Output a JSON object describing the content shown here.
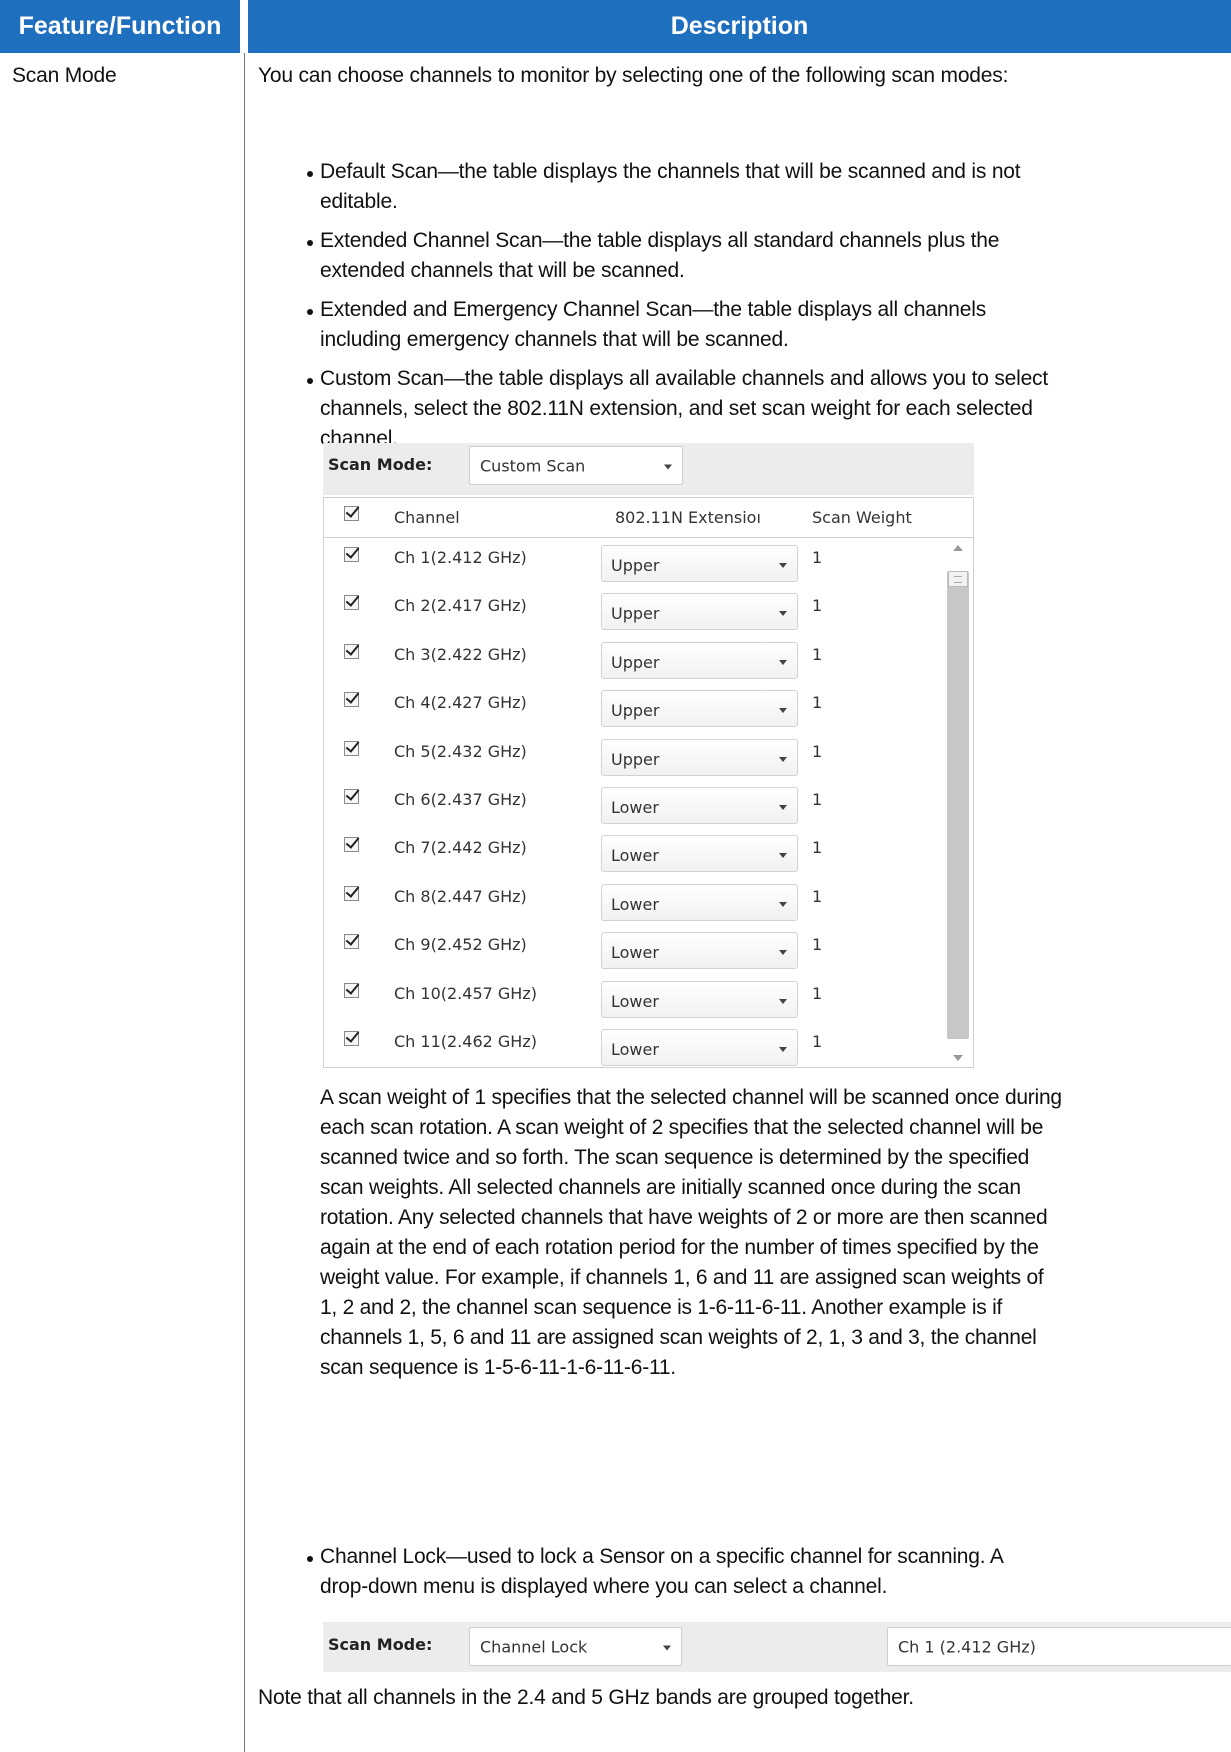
{
  "header": {
    "feature_col": "Feature/Function",
    "description_col": "Description"
  },
  "feature": "Scan Mode",
  "intro": "You can choose channels to monitor by selecting one of the following scan modes:",
  "bullets": {
    "default": [
      "Default Scan—the table displays the channels that will be scanned and is not",
      "editable."
    ],
    "extended": [
      "Extended Channel Scan—the table displays all standard channels plus the",
      "extended channels that will be scanned."
    ],
    "emergency": [
      "Extended and Emergency Channel Scan—the table displays all channels",
      "including emergency channels that will be scanned."
    ],
    "custom": [
      "Custom Scan—the table displays all available channels and allows you to select",
      "channels, select the 802.11N extension, and set scan weight for each selected",
      "channel."
    ],
    "lock": [
      "Channel Lock—used to lock a Sensor on a specific channel for scanning. A",
      "drop-down menu is displayed where you can select a channel."
    ]
  },
  "custom_ui": {
    "scan_mode_label": "Scan Mode:",
    "scan_mode_value": "Custom Scan",
    "columns": {
      "channel": "Channel",
      "extension": "802.11N Extensioı",
      "weight": "Scan Weight"
    },
    "rows": [
      {
        "channel": "Ch 1(2.412 GHz)",
        "extension": "Upper",
        "weight": "1",
        "checked": true
      },
      {
        "channel": "Ch 2(2.417 GHz)",
        "extension": "Upper",
        "weight": "1",
        "checked": true
      },
      {
        "channel": "Ch 3(2.422 GHz)",
        "extension": "Upper",
        "weight": "1",
        "checked": true
      },
      {
        "channel": "Ch 4(2.427 GHz)",
        "extension": "Upper",
        "weight": "1",
        "checked": true
      },
      {
        "channel": "Ch 5(2.432 GHz)",
        "extension": "Upper",
        "weight": "1",
        "checked": true
      },
      {
        "channel": "Ch 6(2.437 GHz)",
        "extension": "Lower",
        "weight": "1",
        "checked": true
      },
      {
        "channel": "Ch 7(2.442 GHz)",
        "extension": "Lower",
        "weight": "1",
        "checked": true
      },
      {
        "channel": "Ch 8(2.447 GHz)",
        "extension": "Lower",
        "weight": "1",
        "checked": true
      },
      {
        "channel": "Ch 9(2.452 GHz)",
        "extension": "Lower",
        "weight": "1",
        "checked": true
      },
      {
        "channel": "Ch 10(2.457 GHz)",
        "extension": "Lower",
        "weight": "1",
        "checked": true
      },
      {
        "channel": "Ch 11(2.462 GHz)",
        "extension": "Lower",
        "weight": "1",
        "checked": true
      }
    ]
  },
  "weight_paragraph": [
    "A scan weight of 1 specifies that the selected channel will be scanned once during",
    "each scan rotation. A scan weight of 2 specifies that the selected channel will be",
    "scanned twice and so forth. The scan sequence is determined by the specified",
    "scan weights. All selected channels are initially scanned once during the scan",
    "rotation. Any selected channels that have weights of 2 or more are then scanned",
    "again at the end of each rotation period for the number of times specified by the",
    "weight value. For example, if channels 1, 6 and 11 are assigned scan weights of",
    "1, 2 and 2, the channel scan sequence is 1-6-11-6-11. Another example is if",
    "channels 1, 5, 6 and 11 are assigned scan weights of 2, 1, 3 and 3, the channel",
    "scan sequence is 1-5-6-11-1-6-11-6-11."
  ],
  "lock_ui": {
    "scan_mode_label": "Scan Mode:",
    "scan_mode_value": "Channel Lock",
    "channel_value": "Ch 1 (2.412 GHz)"
  },
  "note": "Note that all channels in the 2.4 and 5 GHz bands are grouped together.",
  "colors": {
    "header_bg": "#1f6fbf",
    "header_text": "#ffffff"
  }
}
